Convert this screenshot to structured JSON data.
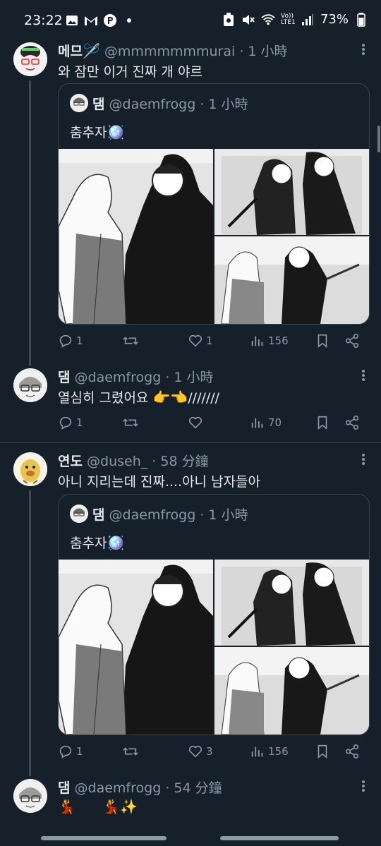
{
  "status_bar": {
    "time": "23:22",
    "net_label": "Vo))\nLTE1",
    "battery": "73%"
  },
  "tweets": [
    {
      "name": "메므",
      "name_emoji": "🪡",
      "handle": "@mmmmmmmurai",
      "time": "1 小時",
      "text": "와 잠만 이거 진짜 개 야르",
      "quote": {
        "name": "댐",
        "handle": "@daemfrogg",
        "time": "1 小時",
        "text": "춤추자",
        "emoji": "🪩"
      },
      "actions": {
        "reply": "1",
        "retweet": "",
        "like": "1",
        "views": "156"
      }
    },
    {
      "name": "댐",
      "handle": "@daemfrogg",
      "time": "1 小時",
      "text": "열심히 그렸어요 ",
      "text_emoji": "👉👈",
      "text_tail": "///////",
      "actions": {
        "reply": "1",
        "retweet": "",
        "like": "",
        "views": "70"
      }
    },
    {
      "name": "연도",
      "handle": "@duseh_",
      "time": "58 分鐘",
      "text": "아니 지리는데 진짜....아니 남자들아",
      "quote": {
        "name": "댐",
        "handle": "@daemfrogg",
        "time": "1 小時",
        "text": "춤추자",
        "emoji": "🪩"
      },
      "actions": {
        "reply": "1",
        "retweet": "",
        "like": "3",
        "views": "156"
      }
    },
    {
      "name": "댐",
      "handle": "@daemfrogg",
      "time": "54 分鐘",
      "text_emoji": "💃      💃✨"
    }
  ],
  "icons": [
    "image-icon",
    "gmail-icon",
    "parking-icon",
    "mute-icon",
    "wifi-icon",
    "signal-icon",
    "battery-icon",
    "reply-icon",
    "retweet-icon",
    "like-icon",
    "views-icon",
    "bookmark-icon",
    "share-icon",
    "more-icon"
  ],
  "colors": {
    "background": "#15202b",
    "text": "#e7e9ea",
    "secondary": "#8b98a5",
    "border": "#38444d"
  }
}
